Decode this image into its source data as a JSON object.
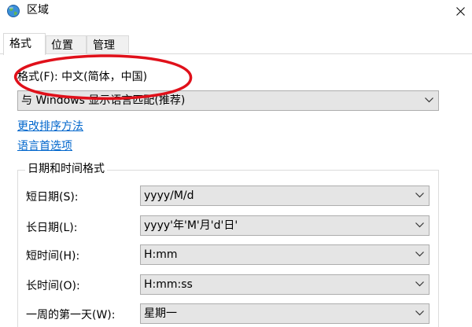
{
  "window": {
    "title": "区域"
  },
  "tabs": [
    {
      "label": "格式",
      "active": true
    },
    {
      "label": "位置",
      "active": false
    },
    {
      "label": "管理",
      "active": false
    }
  ],
  "format": {
    "label": "格式(F): 中文(简体，中国)",
    "select_value": "与 Windows 显示语言匹配(推荐)"
  },
  "links": {
    "change_sort": "更改排序方法",
    "language_prefs": "语言首选项"
  },
  "datetime": {
    "group_title": "日期和时间格式",
    "rows": [
      {
        "label": "短日期(S):",
        "value": "yyyy/M/d"
      },
      {
        "label": "长日期(L):",
        "value": "yyyy'年'M'月'd'日'"
      },
      {
        "label": "短时间(H):",
        "value": "H:mm"
      },
      {
        "label": "长时间(O):",
        "value": "H:mm:ss"
      },
      {
        "label": "一周的第一天(W):",
        "value": "星期一"
      }
    ]
  },
  "annotation": {
    "color": "#e0101a"
  },
  "icons": {
    "app": "globe-icon",
    "close": "close-icon",
    "dropdown": "chevron-down-icon"
  }
}
